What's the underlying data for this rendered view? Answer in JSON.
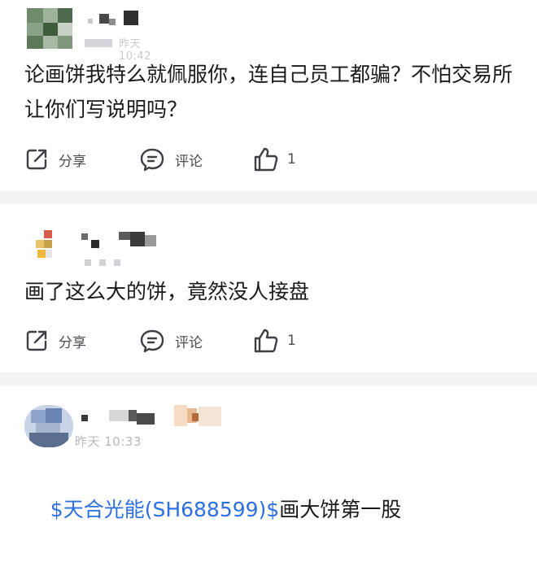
{
  "posts": [
    {
      "meta": "昨天 10:42",
      "content": "论画饼我特么就佩服你，连自己员工都骗？不怕交易所让你们写说明吗？",
      "actions": {
        "share": "分享",
        "comment": "评论",
        "like_count": "1"
      }
    },
    {
      "content": "画了这么大的饼，竟然没人接盘",
      "actions": {
        "share": "分享",
        "comment": "评论",
        "like_count": "1"
      }
    },
    {
      "meta": "昨天 10:33",
      "stock_tag": "$天合光能(SH688599)$",
      "content": "画大饼第一股"
    }
  ],
  "icons": {
    "share": "share-icon",
    "comment": "comment-icon",
    "like": "thumbs-up-icon"
  },
  "colors": {
    "stock_link": "#2e6fe0",
    "separator": "#f2f3f5",
    "meta_text": "#b4b7bd"
  }
}
